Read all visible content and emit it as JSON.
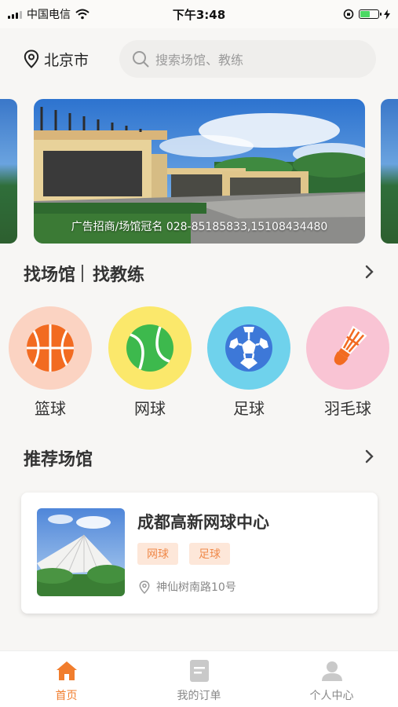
{
  "status_bar": {
    "carrier": "中国电信",
    "time": "下午3:48",
    "battery_color": "#4cd964"
  },
  "header": {
    "city": "北京市",
    "search_placeholder": "搜索场馆、教练"
  },
  "banner": {
    "caption": "广告招商/场馆冠名 028-85185833,15108434480"
  },
  "finder": {
    "tab_venue": "找场馆",
    "tab_coach": "找教练"
  },
  "categories": [
    {
      "label": "篮球",
      "icon": "basketball-icon",
      "bg": "#fbd3c2"
    },
    {
      "label": "网球",
      "icon": "tennis-ball-icon",
      "bg": "#fbe86b"
    },
    {
      "label": "足球",
      "icon": "soccer-ball-icon",
      "bg": "#6fd2ec"
    },
    {
      "label": "羽毛球",
      "icon": "shuttlecock-icon",
      "bg": "#f9c4d4"
    }
  ],
  "recommended": {
    "title": "推荐场馆",
    "venue": {
      "name": "成都高新网球中心",
      "tags": [
        "网球",
        "足球"
      ],
      "address": "神仙树南路10号"
    }
  },
  "tabbar": {
    "items": [
      {
        "label": "首页",
        "icon": "home-icon",
        "active": true
      },
      {
        "label": "我的订单",
        "icon": "order-list-icon",
        "active": false
      },
      {
        "label": "个人中心",
        "icon": "user-icon",
        "active": false
      }
    ]
  },
  "colors": {
    "accent": "#f17d2d",
    "tag_bg": "#fde7d9",
    "tag_text": "#f08a4b"
  }
}
